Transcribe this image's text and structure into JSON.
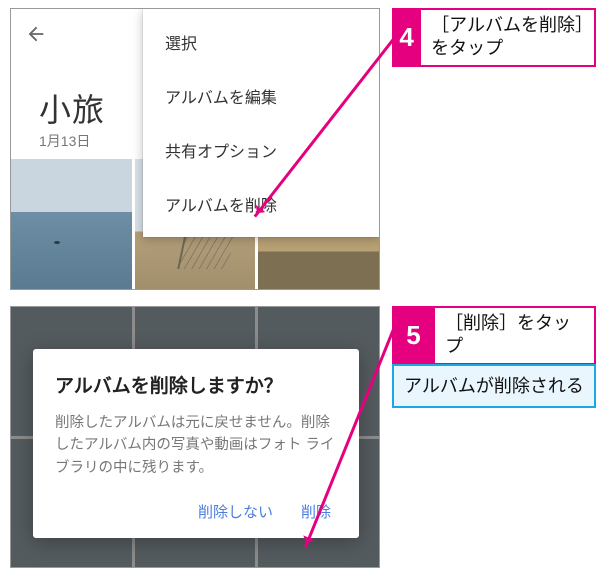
{
  "fig1": {
    "album_title": "小旅",
    "album_date": "1月13日",
    "menu": {
      "select": "選択",
      "edit": "アルバムを編集",
      "share": "共有オプション",
      "delete": "アルバムを削除"
    }
  },
  "fig2": {
    "dialog_title": "アルバムを削除しますか？",
    "dialog_body": "削除したアルバムは元に戻せません。削除したアルバム内の写真や動画はフォト ライブラリの中に残ります。",
    "btn_cancel": "削除しない",
    "btn_delete": "削除"
  },
  "callouts": {
    "step4_num": "4",
    "step4_text": "［アルバムを削除］をタップ",
    "step5_num": "5",
    "step5_text": "［削除］をタップ",
    "result_text": "アルバムが削除される"
  }
}
